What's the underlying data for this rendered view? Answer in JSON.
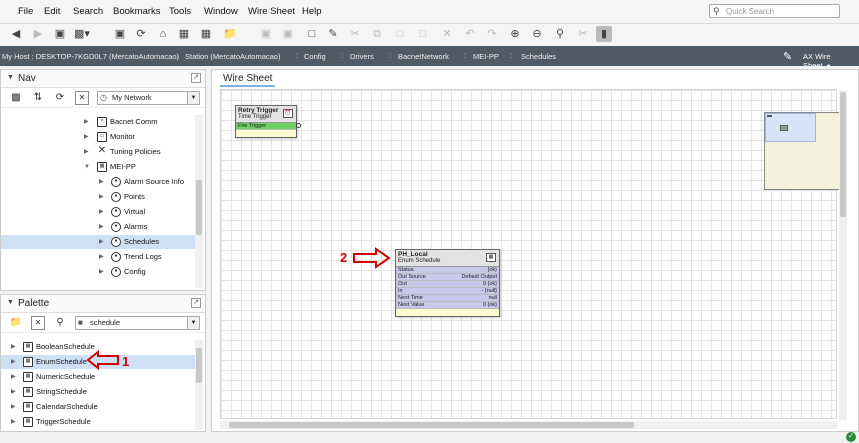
{
  "menubar": {
    "items": [
      "File",
      "Edit",
      "Search",
      "Bookmarks",
      "Tools",
      "Window",
      "Wire Sheet",
      "Help"
    ],
    "search_placeholder": "Quick Search"
  },
  "toolbar": {
    "icons": [
      "back-icon",
      "forward-icon",
      "up-icon",
      "home-folder-icon",
      "view-icon",
      "refresh-icon",
      "home-icon",
      "save-icon",
      "open-icon",
      "folder-icon",
      "save-icon",
      "save-all-icon",
      "export-icon",
      "cut-icon",
      "copy-icon",
      "paste-icon",
      "delete-icon",
      "undo-icon",
      "redo-icon",
      "zoom-in-icon",
      "zoom-out-icon",
      "zoom-fit-icon",
      "cut-wire-icon",
      "pin-icon"
    ]
  },
  "pathbar": {
    "crumbs": [
      "My Host : DESKTOP-7KGD0L7 (MercatoAutomacao)",
      "Station (MercatoAutomacao)",
      "Config",
      "Drivers",
      "BacnetNetwork",
      "MEI-PP",
      "Schedules"
    ],
    "view": "AX Wire Sheet"
  },
  "nav": {
    "title": "Nav",
    "network_combo": "My Network",
    "items": [
      {
        "label": "Bacnet Comm"
      },
      {
        "label": "Monitor"
      },
      {
        "label": "Tuning Policies"
      },
      {
        "label": "MEI-PP"
      },
      {
        "label": "Alarm Source Info"
      },
      {
        "label": "Points"
      },
      {
        "label": "Virtual"
      },
      {
        "label": "Alarms"
      },
      {
        "label": "Schedules"
      },
      {
        "label": "Trend Logs"
      },
      {
        "label": "Config"
      }
    ]
  },
  "palette": {
    "title": "Palette",
    "module_combo": "schedule",
    "items": [
      {
        "label": "BooleanSchedule"
      },
      {
        "label": "EnumSchedule"
      },
      {
        "label": "NumericSchedule"
      },
      {
        "label": "StringSchedule"
      },
      {
        "label": "CalendarSchedule"
      },
      {
        "label": "TriggerSchedule"
      }
    ]
  },
  "sheet": {
    "tab": "Wire Sheet",
    "retry": {
      "name": "Retry Trigger",
      "type": "Time Trigger",
      "slot": "Fire Trigger"
    },
    "enum": {
      "name": "PH_Local",
      "type": "Enum Schedule",
      "slots": [
        {
          "label": "Status",
          "value": "{ok}"
        },
        {
          "label": "Out Source",
          "value": "Default Output"
        },
        {
          "label": "Out",
          "value": "0 {ok}"
        },
        {
          "label": "In",
          "value": "- {null}"
        },
        {
          "label": "Next Time",
          "value": "null"
        },
        {
          "label": "Next Value",
          "value": "0 {ok}"
        }
      ]
    }
  },
  "annotations": {
    "one": "1",
    "two": "2"
  },
  "colors": {
    "accent_red": "#d00000",
    "selection": "#cfe0f5",
    "pathbar": "#4f5a67",
    "fire_slot": "#6bd160",
    "enum_slots": "#c8c8ea"
  }
}
